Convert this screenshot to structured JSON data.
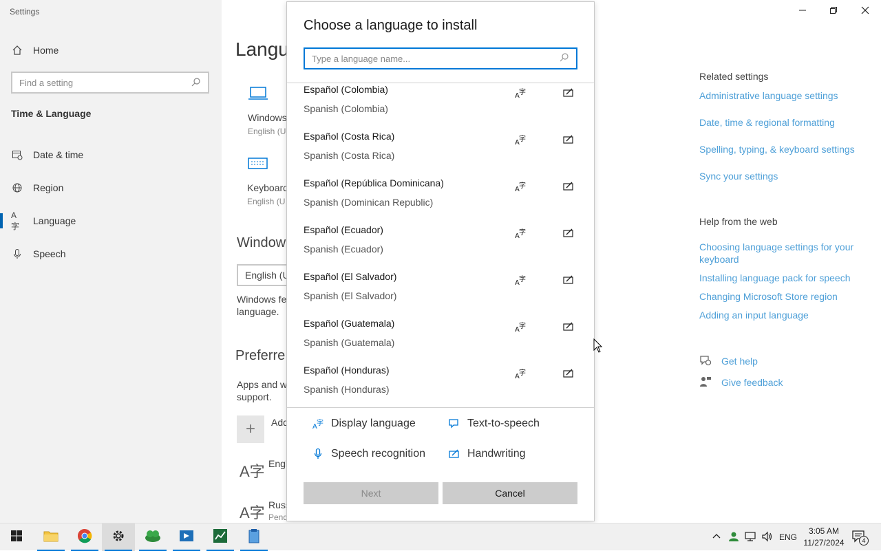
{
  "app": {
    "title": "Settings"
  },
  "sidebar": {
    "home": "Home",
    "search_placeholder": "Find a setting",
    "section": "Time & Language",
    "items": [
      {
        "label": "Date & time",
        "icon": "calendar-clock-icon"
      },
      {
        "label": "Region",
        "icon": "globe-icon"
      },
      {
        "label": "Language",
        "icon": "language-icon",
        "active": true
      },
      {
        "label": "Speech",
        "icon": "microphone-icon"
      }
    ]
  },
  "main": {
    "title": "Langu",
    "tiles": [
      {
        "title": "Windows",
        "sub": "English (U"
      },
      {
        "title": "Keyboard",
        "sub": "English (U"
      }
    ],
    "windows_heading": "Window",
    "dropdown_value": "English (U",
    "windows_desc_1": "Windows fe",
    "windows_desc_2": "language.",
    "preferred_heading": "Preferre",
    "apps_desc_1": "Apps and w",
    "apps_desc_2": "support.",
    "add_label": "Add",
    "lang_entries": [
      {
        "name": "Engl"
      },
      {
        "name": "Russ",
        "status": "Pendi"
      }
    ]
  },
  "related": {
    "title": "Related settings",
    "links": [
      "Administrative language settings",
      "Date, time & regional formatting",
      "Spelling, typing, & keyboard settings",
      "Sync your settings"
    ],
    "help_title": "Help from the web",
    "help_links": [
      "Choosing language settings for your keyboard",
      "Installing language pack for speech",
      "Changing Microsoft Store region",
      "Adding an input language"
    ],
    "get_help": "Get help",
    "give_feedback": "Give feedback"
  },
  "dialog": {
    "title": "Choose a language to install",
    "search_placeholder": "Type a language name...",
    "languages": [
      {
        "native": "Español (Colombia)",
        "english": "Spanish (Colombia)"
      },
      {
        "native": "Español (Costa Rica)",
        "english": "Spanish (Costa Rica)"
      },
      {
        "native": "Español (República Dominicana)",
        "english": "Spanish (Dominican Republic)"
      },
      {
        "native": "Español (Ecuador)",
        "english": "Spanish (Ecuador)"
      },
      {
        "native": "Español (El Salvador)",
        "english": "Spanish (El Salvador)"
      },
      {
        "native": "Español (Guatemala)",
        "english": "Spanish (Guatemala)"
      },
      {
        "native": "Español (Honduras)",
        "english": "Spanish (Honduras)"
      }
    ],
    "legend": {
      "display_language": "Display language",
      "text_to_speech": "Text-to-speech",
      "speech_recognition": "Speech recognition",
      "handwriting": "Handwriting"
    },
    "next_label": "Next",
    "cancel_label": "Cancel"
  },
  "taskbar": {
    "apps": [
      "start-icon",
      "file-explorer-icon",
      "chrome-icon",
      "settings-icon",
      "app-green-icon",
      "app-blue-icon",
      "app-chart-icon",
      "app-notepad-icon"
    ],
    "lang": "ENG",
    "time": "3:05 AM",
    "date": "11/27/2024",
    "notifications": "4"
  },
  "colors": {
    "accent": "#0078d7",
    "link": "#4fa0d8"
  }
}
